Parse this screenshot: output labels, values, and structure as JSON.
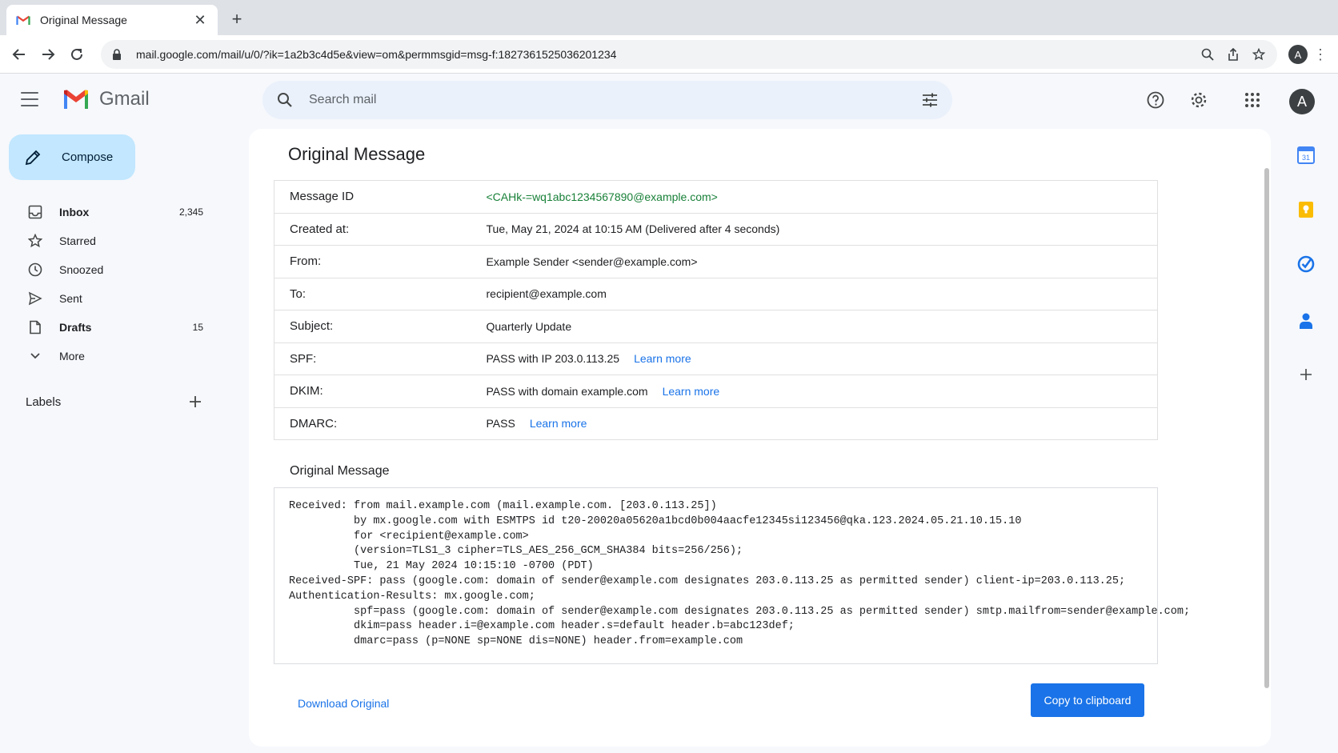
{
  "browser": {
    "tab_title": "Original Message",
    "tab_close": "✕",
    "new_tab": "+",
    "url": "mail.google.com/mail/u/0/?ik=1a2b3c4d5e&view=om&permmsgid=msg-f:1827361525036201234",
    "profile_initial": "A",
    "menu": "⋮"
  },
  "header": {
    "brand": "Gmail",
    "search_placeholder": "Search mail",
    "avatar_initial": "A"
  },
  "sidebar": {
    "compose_label": "Compose",
    "items": [
      {
        "label": "Inbox",
        "count": "2,345",
        "icon": "inbox-icon",
        "bold": true
      },
      {
        "label": "Starred",
        "count": "",
        "icon": "star-icon",
        "bold": false
      },
      {
        "label": "Snoozed",
        "count": "",
        "icon": "clock-icon",
        "bold": false
      },
      {
        "label": "Sent",
        "count": "",
        "icon": "send-icon",
        "bold": false
      },
      {
        "label": "Drafts",
        "count": "15",
        "icon": "draft-icon",
        "bold": true
      },
      {
        "label": "More",
        "count": "",
        "icon": "chevron-down-icon",
        "bold": false
      }
    ],
    "labels_title": "Labels",
    "labels_add": "+"
  },
  "main": {
    "title": "Original Message",
    "meta": {
      "message_id_label": "Message ID",
      "message_id": "<CAHk-=wq1abc1234567890@example.com>",
      "created_label": "Created at:",
      "created": "Tue, May 21, 2024 at 10:15 AM (Delivered after 4 seconds)",
      "from_label": "From:",
      "from": "Example Sender <sender@example.com>",
      "to_label": "To:",
      "to": "recipient@example.com",
      "subject_label": "Subject:",
      "subject": "Quarterly Update",
      "spf_label": "SPF:",
      "spf": "PASS with IP 203.0.113.25",
      "dkim_label": "DKIM:",
      "dkim": "PASS with domain example.com",
      "dmarc_label": "DMARC:",
      "dmarc": "PASS",
      "learn_more": "Learn more"
    },
    "original_heading": "Original Message",
    "raw_headers": "Received: from mail.example.com (mail.example.com. [203.0.113.25])\n          by mx.google.com with ESMTPS id t20-20020a05620a1bcd0b004aacfe12345si123456@qka.123.2024.05.21.10.15.10\n          for <recipient@example.com>\n          (version=TLS1_3 cipher=TLS_AES_256_GCM_SHA384 bits=256/256);\n          Tue, 21 May 2024 10:15:10 -0700 (PDT)\nReceived-SPF: pass (google.com: domain of sender@example.com designates 203.0.113.25 as permitted sender) client-ip=203.0.113.25;\nAuthentication-Results: mx.google.com;\n          spf=pass (google.com: domain of sender@example.com designates 203.0.113.25 as permitted sender) smtp.mailfrom=sender@example.com;\n          dkim=pass header.i=@example.com header.s=default header.b=abc123def;\n          dmarc=pass (p=NONE sp=NONE dis=NONE) header.from=example.com",
    "download_label": "Download Original",
    "copy_label": "Copy to clipboard"
  },
  "side_panel": {
    "calendar_day": "31",
    "add": "+"
  },
  "colors": {
    "accent": "#1a73e8",
    "compose_bg": "#c2e7ff",
    "message_id": "#188038",
    "search_bg": "#eaf1fb"
  }
}
